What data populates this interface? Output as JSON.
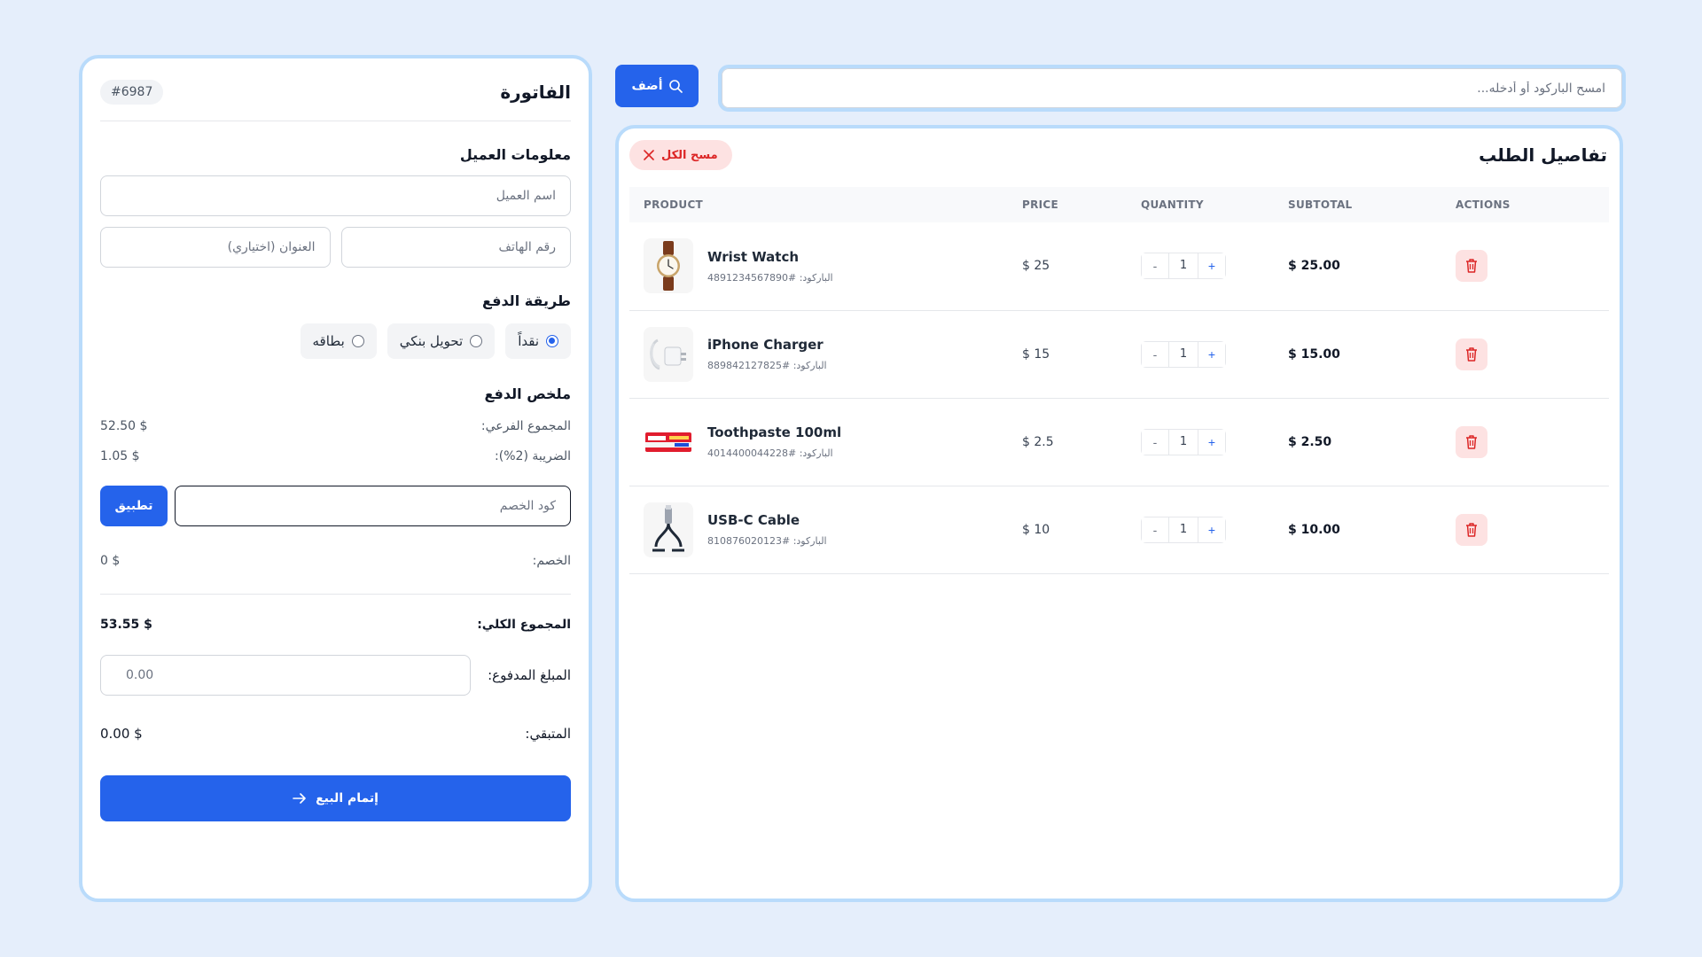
{
  "colors": {
    "accent": "#2563eb",
    "danger": "#dc2626",
    "panel_border": "#b9dbfb",
    "background": "#e5eefb"
  },
  "search": {
    "placeholder": "امسح الباركود أو أدخله...",
    "button_label": "أضف",
    "button_icon": "search-icon"
  },
  "order": {
    "title": "تفاصيل الطلب",
    "clear_label": "مسح الكل",
    "columns": {
      "product": "PRODUCT",
      "price": "PRICE",
      "quantity": "QUANTITY",
      "subtotal": "SUBTOTAL",
      "actions": "ACTIONS"
    },
    "items": [
      {
        "name": "Wrist Watch",
        "barcode": "الباركود: #4891234567890",
        "price": "$ 25",
        "qty": "1",
        "subtotal": "$ 25.00",
        "icon": "wrist-watch-image"
      },
      {
        "name": "iPhone Charger",
        "barcode": "الباركود: #889842127825",
        "price": "$ 15",
        "qty": "1",
        "subtotal": "$ 15.00",
        "icon": "charger-image"
      },
      {
        "name": "Toothpaste 100ml",
        "barcode": "الباركود: #4014400044228",
        "price": "$ 2.5",
        "qty": "1",
        "subtotal": "$ 2.50",
        "icon": "toothpaste-image"
      },
      {
        "name": "USB-C Cable",
        "barcode": "الباركود: #810876020123",
        "price": "$ 10",
        "qty": "1",
        "subtotal": "$ 10.00",
        "icon": "usb-cable-image"
      }
    ],
    "qty_minus": "-",
    "qty_plus": "+"
  },
  "invoice": {
    "title": "الفاتورة",
    "number": "#6987",
    "customer_section": "معلومات العميل",
    "customer_name_placeholder": "اسم العميل",
    "phone_placeholder": "رقم الهاتف",
    "address_placeholder": "العنوان (اختياري)",
    "payment_section": "طريقة الدفع",
    "payment_methods": [
      {
        "label": "نقداً",
        "selected": true
      },
      {
        "label": "تحويل بنكي",
        "selected": false
      },
      {
        "label": "بطاقه",
        "selected": false
      }
    ],
    "summary_section": "ملخص الدفع",
    "subtotal_label": "المجموع الفرعي:",
    "subtotal_value": "52.50 $",
    "tax_label": "الضريبة (2%):",
    "tax_value": "1.05 $",
    "discount_code_placeholder": "كود الخصم",
    "apply_label": "تطبيق",
    "discount_label": "الخصم:",
    "discount_value": "0 $",
    "total_label": "المجموع الكلي:",
    "total_value": "53.55 $",
    "paid_label": "المبلغ المدفوع:",
    "paid_placeholder": "0.00",
    "remaining_label": "المتبقي:",
    "remaining_value": "0.00 $",
    "complete_label": "إتمام البيع"
  }
}
